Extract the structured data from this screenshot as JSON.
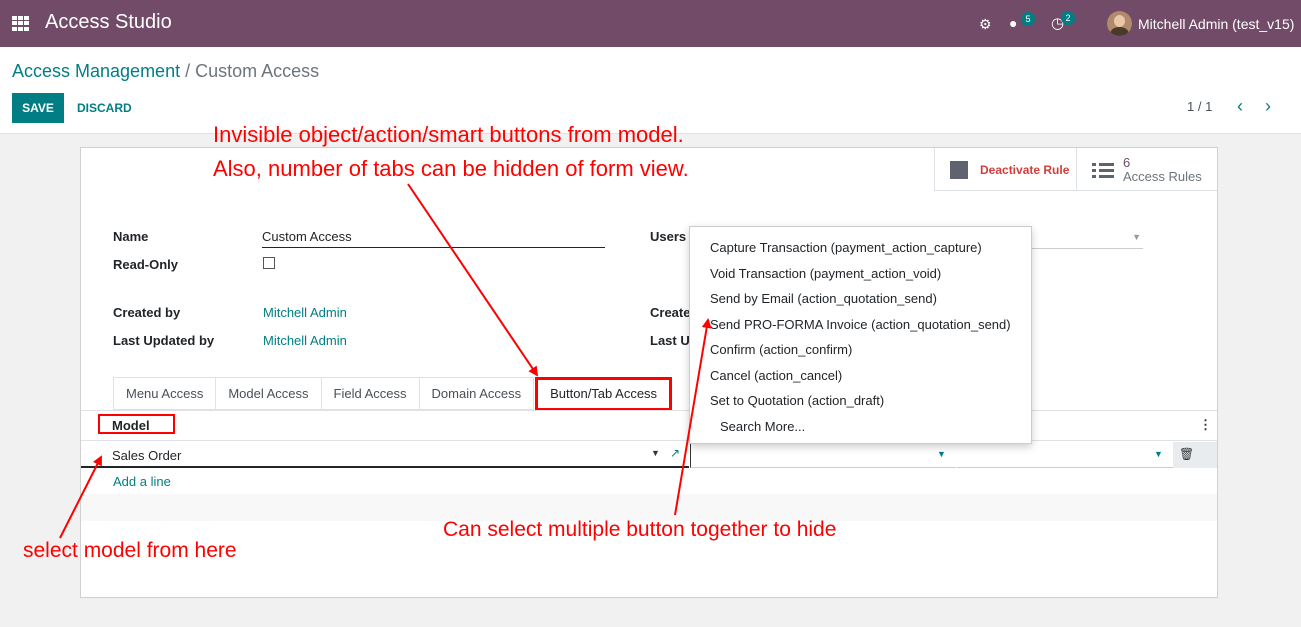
{
  "topbar": {
    "app_title": "Access Studio",
    "messages_badge": "5",
    "activities_badge": "2",
    "user_name": "Mitchell Admin (test_v15)"
  },
  "breadcrumb": {
    "parent": "Access Management",
    "separator": " / ",
    "current": "Custom Access"
  },
  "toolbar": {
    "save_label": "SAVE",
    "discard_label": "DISCARD"
  },
  "pager": {
    "value": "1 / 1",
    "prev_icon": "chevron-left-icon",
    "next_icon": "chevron-right-icon"
  },
  "smart_buttons": {
    "deactivate_label": "Deactivate Rule",
    "rules_count": "6",
    "rules_label": "Access Rules"
  },
  "form": {
    "name_label": "Name",
    "name_value": "Custom Access",
    "readonly_label": "Read-Only",
    "readonly_checked": false,
    "users_label": "Users",
    "created_by_label": "Created by",
    "created_by_value": "Mitchell Admin",
    "last_updated_by_label": "Last Updated by",
    "last_updated_by_value": "Mitchell Admin",
    "created_on_label": "Created",
    "last_updated_on_label": "Last Up"
  },
  "tabs": [
    {
      "label": "Menu Access",
      "active": false
    },
    {
      "label": "Model Access",
      "active": false
    },
    {
      "label": "Field Access",
      "active": false
    },
    {
      "label": "Domain Access",
      "active": false
    },
    {
      "label": "Button/Tab Access",
      "active": true
    }
  ],
  "table": {
    "column_model": "Model",
    "row_model_value": "Sales Order",
    "add_line_label": "Add a line"
  },
  "dropdown": {
    "items": [
      "Capture Transaction (payment_action_capture)",
      "Void Transaction (payment_action_void)",
      "Send by Email (action_quotation_send)",
      "Send PRO-FORMA Invoice (action_quotation_send)",
      "Confirm (action_confirm)",
      "Cancel (action_cancel)",
      "Set to Quotation (action_draft)"
    ],
    "search_more": "Search More..."
  },
  "annotations": {
    "top_line1": "Invisible object/action/smart buttons from model.",
    "top_line2": "Also, number of tabs can be hidden of form view.",
    "bottom_right": "Can select multiple button together to hide",
    "bottom_left": "select model from here"
  },
  "colors": {
    "brand": "#714b67",
    "accent": "#017e84",
    "annotation": "#ff0000",
    "danger": "#d23f3a"
  }
}
